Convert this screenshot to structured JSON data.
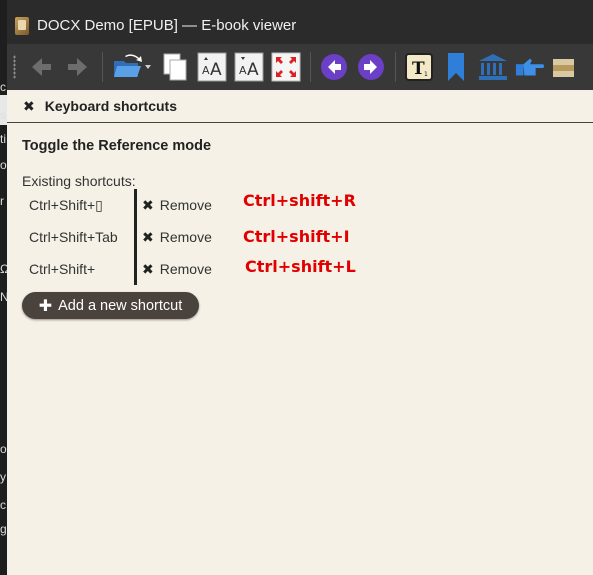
{
  "window": {
    "title": "DOCX Demo [EPUB] — E-book viewer"
  },
  "left_strip_text": [
    "c",
    "s",
    "ti",
    "ol",
    "r",
    "Ω",
    "N",
    "o,",
    "y",
    "c",
    "g"
  ],
  "toolbar": {
    "buttons": [
      {
        "name": "back-icon"
      },
      {
        "name": "forward-icon"
      },
      {
        "name": "open-book-icon"
      },
      {
        "name": "copy-icon"
      },
      {
        "name": "font-increase-icon"
      },
      {
        "name": "font-decrease-icon"
      },
      {
        "name": "fullscreen-icon"
      },
      {
        "name": "previous-page-icon"
      },
      {
        "name": "next-page-icon"
      },
      {
        "name": "reference-mode-icon"
      },
      {
        "name": "bookmark-icon"
      },
      {
        "name": "library-icon"
      },
      {
        "name": "pointer-hand-icon"
      },
      {
        "name": "books-icon"
      }
    ]
  },
  "panel": {
    "header": "Keyboard shortcuts",
    "action_title": "Toggle the Reference mode",
    "existing_label": "Existing shortcuts:",
    "shortcuts": [
      {
        "keys": "Ctrl+Shift+▯",
        "remove": "Remove",
        "annotation": "Ctrl+shift+R"
      },
      {
        "keys": "Ctrl+Shift+Tab",
        "remove": "Remove",
        "annotation": "Ctrl+shift+I"
      },
      {
        "keys": "Ctrl+Shift+",
        "remove": "Remove",
        "annotation": "Ctrl+shift+L"
      }
    ],
    "add_button": "Add a new shortcut"
  },
  "colors": {
    "annotation": "#e00000",
    "panel_bg": "#f5f1e6",
    "toolbar_bg": "#383838",
    "accent_purple": "#6b3fc6",
    "accent_blue": "#2f7fd8"
  }
}
